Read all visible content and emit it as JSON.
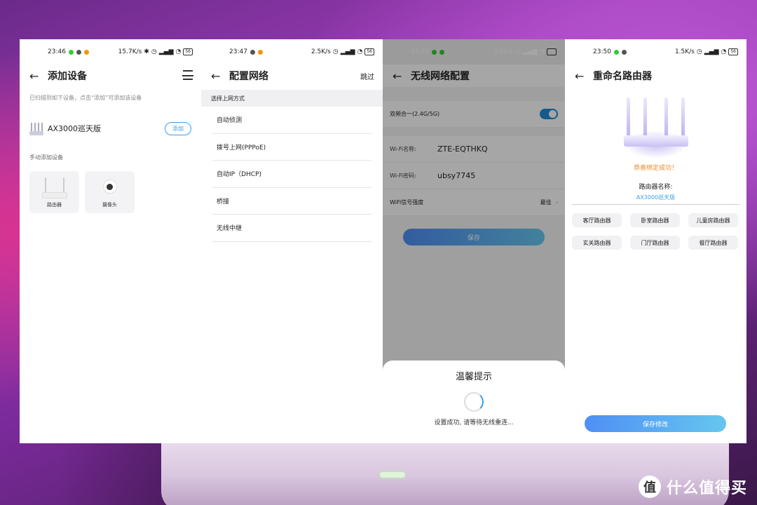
{
  "screen1": {
    "status": {
      "time": "23:46",
      "speed": "15.7K/s",
      "battery": "56"
    },
    "title": "添加设备",
    "hint": "已扫描到如下设备，点击“添加”可添加该设备",
    "found_device": {
      "name": "AX3000巡天版",
      "add_label": "添加"
    },
    "manual_label": "手动添加设备",
    "tiles": [
      {
        "label": "路由器",
        "icon": "router-icon"
      },
      {
        "label": "摄像头",
        "icon": "camera-icon"
      }
    ]
  },
  "screen2": {
    "status": {
      "time": "23:47",
      "speed": "2.5K/s",
      "battery": "56"
    },
    "title": "配置网络",
    "skip_label": "跳过",
    "section": "选择上网方式",
    "options": [
      "自动侦测",
      "拨号上网(PPPoE)",
      "自动IP（DHCP)",
      "桥接",
      "无线中继"
    ]
  },
  "screen3": {
    "status": {
      "time": "23:50",
      "speed": "3.9K/s",
      "battery": "56"
    },
    "title": "无线网络配置",
    "dual_band_label": "双频合一(2.4G/5G)",
    "dual_band_on": true,
    "wifi_name_label": "Wi-Fi名称:",
    "wifi_name_value": "ZTE-EQTHKQ",
    "wifi_pwd_label": "Wi-Fi密码:",
    "wifi_pwd_value": "ubsy7745",
    "signal_label": "WiFi信号强度",
    "signal_value": "最佳",
    "save_label": "保存",
    "dialog": {
      "title": "温馨提示",
      "message": "设置成功, 请等待无线重连..."
    }
  },
  "screen4": {
    "status": {
      "time": "23:50",
      "speed": "1.5K/s",
      "battery": "56"
    },
    "title": "重命名路由器",
    "success": "恭喜绑定成功！",
    "name_label": "路由器名称:",
    "name_value": "AX3000巡天版",
    "chips": [
      "客厅路由器",
      "卧室路由器",
      "儿童房路由器",
      "玄关路由器",
      "门厅路由器",
      "餐厅路由器"
    ],
    "save_label": "保存修改"
  },
  "watermark": {
    "text": "什么值得买",
    "logo": "值"
  },
  "colors": {
    "accent": "#3aa0e8",
    "success": "#f08a24",
    "toggle": "#1f8bd6"
  }
}
